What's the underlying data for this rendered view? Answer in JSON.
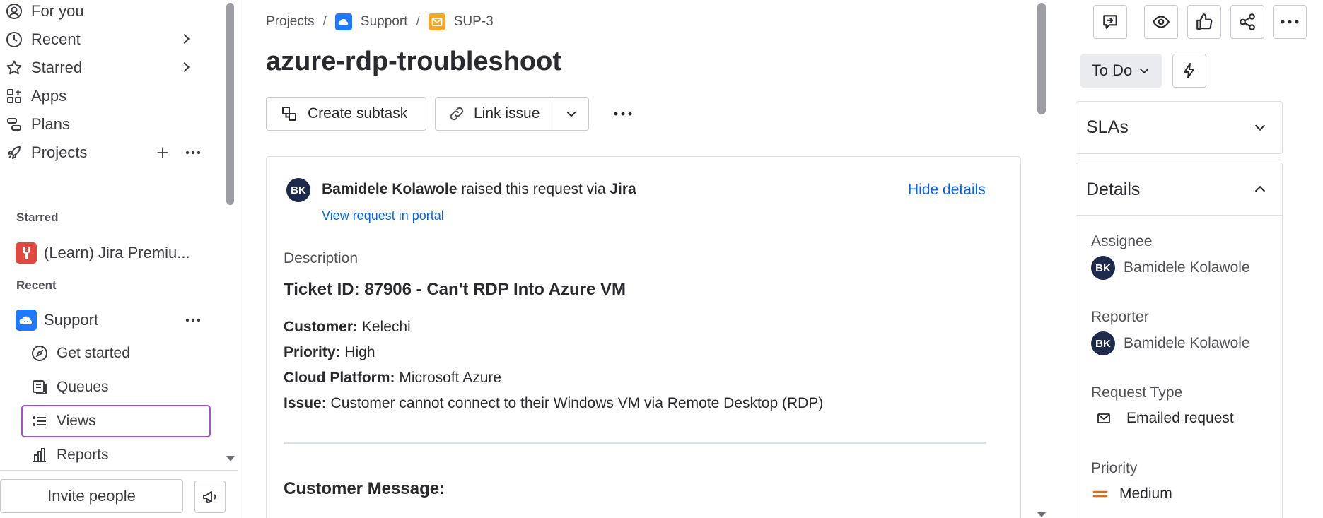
{
  "sidebar": {
    "nav": [
      {
        "label": "For you",
        "icon": "user-circle-icon"
      },
      {
        "label": "Recent",
        "icon": "clock-icon"
      },
      {
        "label": "Starred",
        "icon": "star-icon"
      },
      {
        "label": "Apps",
        "icon": "apps-icon"
      },
      {
        "label": "Plans",
        "icon": "plans-icon"
      },
      {
        "label": "Projects",
        "icon": "rocket-icon"
      }
    ],
    "starred_label": "Starred",
    "starred_project": "(Learn) Jira Premiu...",
    "recent_label": "Recent",
    "recent_project": "Support",
    "project_items": [
      {
        "label": "Get started",
        "icon": "compass-icon"
      },
      {
        "label": "Queues",
        "icon": "queue-icon"
      },
      {
        "label": "Views",
        "icon": "list-icon"
      },
      {
        "label": "Reports",
        "icon": "chart-icon"
      }
    ],
    "invite_label": "Invite people"
  },
  "breadcrumb": {
    "projects": "Projects",
    "sep": "/",
    "project": "Support",
    "issue_key": "SUP-3"
  },
  "issue": {
    "title": "azure-rdp-troubleshoot",
    "create_subtask": "Create subtask",
    "link_issue": "Link issue"
  },
  "request": {
    "avatar_initials": "BK",
    "reporter_name": "Bamidele Kolawole",
    "raised_text": " raised this request via ",
    "via": "Jira",
    "hide_details": "Hide details",
    "view_portal": "View request in portal"
  },
  "description": {
    "label": "Description",
    "heading": "Ticket ID: 87906 - Can't RDP Into Azure VM",
    "fields": [
      {
        "key": "Customer:",
        "value": " Kelechi"
      },
      {
        "key": "Priority:",
        "value": " High"
      },
      {
        "key": "Cloud Platform:",
        "value": " Microsoft Azure"
      },
      {
        "key": "Issue:",
        "value": " Customer cannot connect to their Windows VM via Remote Desktop (RDP)"
      }
    ],
    "customer_message": "Customer Message:"
  },
  "right_panel": {
    "status": "To Do",
    "slas_label": "SLAs",
    "details_label": "Details",
    "assignee_label": "Assignee",
    "assignee": "Bamidele Kolawole",
    "reporter_label": "Reporter",
    "reporter": "Bamidele Kolawole",
    "avatar_initials": "BK",
    "request_type_label": "Request Type",
    "request_type": "Emailed request",
    "priority_label": "Priority",
    "priority": "Medium"
  },
  "colors": {
    "accent": "#0c66e4",
    "selected_outline": "#a44fd6",
    "avatar_bg": "#1d2a4b",
    "support_project": "#1d7afc",
    "learn_project": "#e2483d",
    "issue_type": "#f5a623",
    "priority_medium": "#e56910"
  }
}
